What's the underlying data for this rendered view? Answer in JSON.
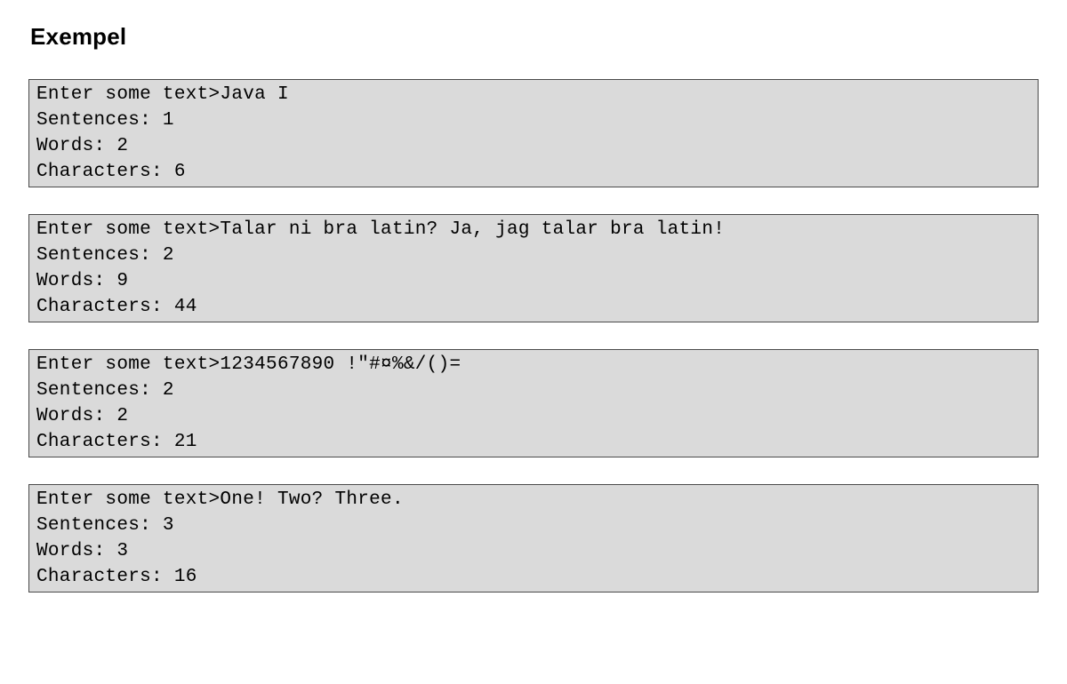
{
  "heading": "Exempel",
  "examples": [
    {
      "text": "Enter some text>Java I\nSentences: 1\nWords: 2\nCharacters: 6"
    },
    {
      "text": "Enter some text>Talar ni bra latin? Ja, jag talar bra latin!\nSentences: 2\nWords: 9\nCharacters: 44"
    },
    {
      "text": "Enter some text>1234567890 !\"#¤%&/()=\nSentences: 2\nWords: 2\nCharacters: 21"
    },
    {
      "text": "Enter some text>One! Two? Three.\nSentences: 3\nWords: 3\nCharacters: 16"
    }
  ]
}
